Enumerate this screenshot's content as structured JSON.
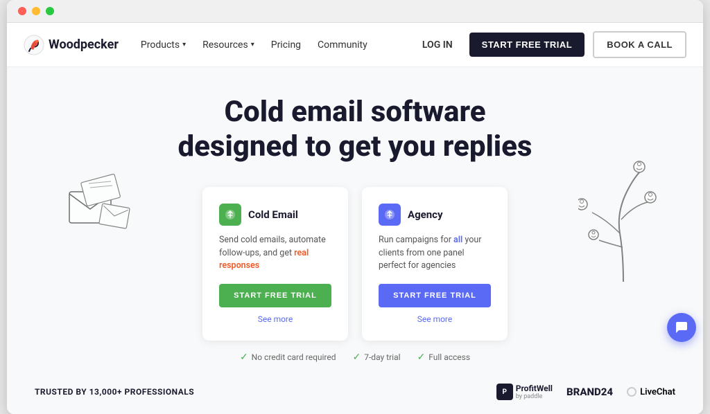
{
  "browser": {
    "dots": [
      "red",
      "yellow",
      "green"
    ]
  },
  "navbar": {
    "logo_text": "Woodpecker",
    "nav_items": [
      {
        "label": "Products",
        "has_chevron": true
      },
      {
        "label": "Resources",
        "has_chevron": true
      },
      {
        "label": "Pricing",
        "has_chevron": false
      },
      {
        "label": "Community",
        "has_chevron": false
      }
    ],
    "login_label": "LOG IN",
    "start_trial_label": "START FREE TRIAL",
    "book_call_label": "BOOK A CALL"
  },
  "hero": {
    "title_line1": "Cold email software",
    "title_line2": "designed to get you replies"
  },
  "cards": [
    {
      "id": "cold-email",
      "icon_text": "🐦",
      "icon_class": "icon-green",
      "title": "Cold Email",
      "description_parts": [
        {
          "text": "Send cold emails, automate follow-ups, and get "
        },
        {
          "text": "real responses",
          "highlight": "orange"
        }
      ],
      "description": "Send cold emails, automate follow-ups, and get real responses",
      "btn_label": "START FREE TRIAL",
      "btn_class": "btn-card-trial-green",
      "see_more": "See more"
    },
    {
      "id": "agency",
      "icon_text": "🐦",
      "icon_class": "icon-blue",
      "title": "Agency",
      "description_parts": [
        {
          "text": "Run campaigns for "
        },
        {
          "text": "all",
          "highlight": "blue"
        },
        {
          "text": " your clients from one panel perfect for "
        },
        {
          "text": "agencies",
          "highlight": "none"
        }
      ],
      "description": "Run campaigns for all your clients from one panel perfect for agencies",
      "btn_label": "START FREE TRIAL",
      "btn_class": "btn-card-trial-blue",
      "see_more": "See more"
    }
  ],
  "trust": {
    "badges": [
      {
        "text": "No credit card required"
      },
      {
        "text": "7-day trial"
      },
      {
        "text": "Full access"
      }
    ],
    "trusted_label": "TRUSTED BY 13,000+ PROFESSIONALS",
    "brands": [
      {
        "name": "ProfitWell",
        "sub": "by paddle"
      },
      {
        "name": "BRAND24"
      },
      {
        "name": "LiveChat"
      }
    ]
  },
  "chat": {
    "icon": "💬"
  }
}
